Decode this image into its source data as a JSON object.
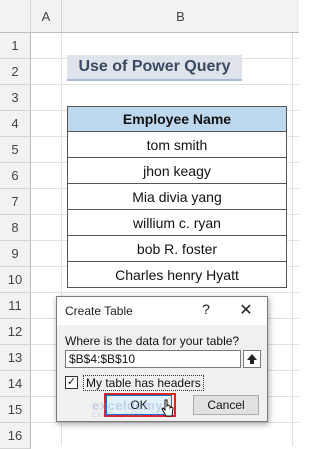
{
  "columns": [
    "A",
    "B"
  ],
  "rows": [
    "1",
    "2",
    "3",
    "4",
    "5",
    "6",
    "7",
    "8",
    "9",
    "10",
    "11",
    "12",
    "13",
    "14",
    "15",
    "16"
  ],
  "sheet": {
    "title": "Use of Power Query",
    "table_header": "Employee Name",
    "employees": [
      "tom smith",
      "jhon keagy",
      "Mia divia yang",
      "willium c. ryan",
      "bob R. foster",
      "Charles henry Hyatt"
    ]
  },
  "dialog": {
    "title": "Create Table",
    "help": "?",
    "close": "✕",
    "prompt": "Where is the data for your table?",
    "range_value": "$B$4:$B$10",
    "headers_label": "My table has headers",
    "headers_checked": true,
    "ok_label": "OK",
    "cancel_label": "Cancel"
  },
  "watermark": {
    "brand": "exceldemy",
    "tagline": "EXCEL · DATA · BI"
  }
}
